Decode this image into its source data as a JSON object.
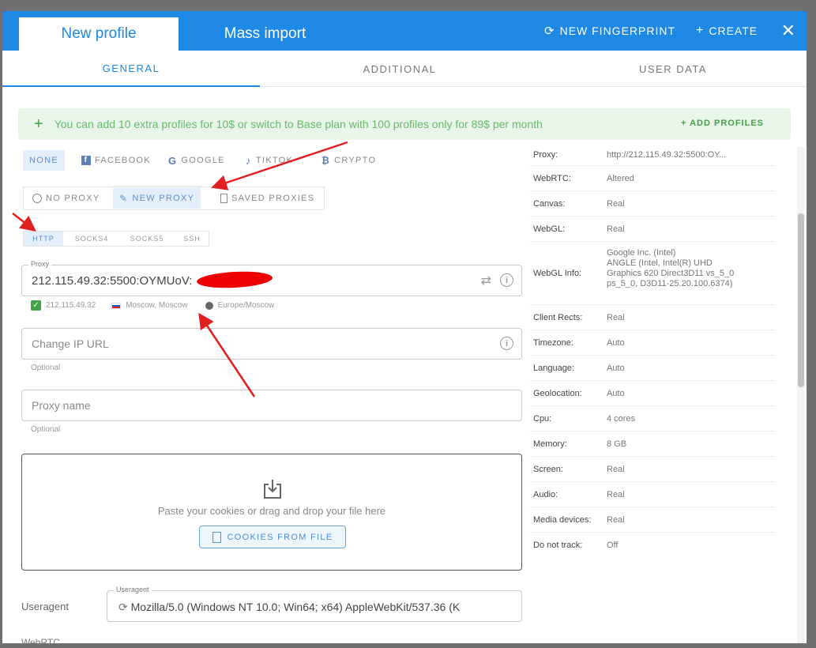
{
  "header": {
    "tab_new_profile": "New profile",
    "tab_mass_import": "Mass import",
    "new_fingerprint": "NEW FINGERPRINT",
    "create": "CREATE",
    "close": "✕"
  },
  "subtabs": [
    "GENERAL",
    "ADDITIONAL",
    "USER DATA"
  ],
  "banner": {
    "text": "You can add 10 extra profiles for 10$ or switch to Base plan with 100 profiles only for 89$ per month",
    "action": "+ ADD PROFILES"
  },
  "platforms": [
    "NONE",
    "FACEBOOK",
    "GOOGLE",
    "TIKTOK",
    "CRYPTO"
  ],
  "proxy_modes": [
    "NO PROXY",
    "NEW PROXY",
    "SAVED PROXIES"
  ],
  "proxy_types": [
    "HTTP",
    "SOCKS4",
    "SOCKS5",
    "SSH"
  ],
  "proxy_field": {
    "label": "Proxy",
    "value": "212.115.49.32:5500:OYMUoV:"
  },
  "proxy_check": {
    "ip": "212.115.49.32",
    "location": "Moscow, Moscow",
    "timezone": "Europe/Moscow"
  },
  "change_ip": {
    "placeholder": "Change IP URL",
    "hint": "Optional"
  },
  "proxy_name": {
    "placeholder": "Proxy name",
    "hint": "Optional"
  },
  "cookies": {
    "text": "Paste your cookies or drag and drop your file here",
    "button": "COOKIES FROM FILE"
  },
  "useragent": {
    "label": "Useragent",
    "field_label": "Useragent",
    "value": "Mozilla/5.0 (Windows NT 10.0; Win64; x64) AppleWebKit/537.36 (K"
  },
  "webrtc_label": "WebRTC",
  "fingerprint": [
    {
      "key": "Proxy:",
      "value": "http://212.115.49.32:5500:OY..."
    },
    {
      "key": "WebRTC:",
      "value": "Altered"
    },
    {
      "key": "Canvas:",
      "value": "Real"
    },
    {
      "key": "WebGL:",
      "value": "Real"
    },
    {
      "key": "WebGL Info:",
      "value": "Google Inc. (Intel)\nANGLE (Intel, Intel(R) UHD Graphics 620 Direct3D11 vs_5_0 ps_5_0, D3D11-25.20.100.6374)"
    },
    {
      "key": "Client Rects:",
      "value": "Real"
    },
    {
      "key": "Timezone:",
      "value": "Auto"
    },
    {
      "key": "Language:",
      "value": "Auto"
    },
    {
      "key": "Geolocation:",
      "value": "Auto"
    },
    {
      "key": "Cpu:",
      "value": "4 cores"
    },
    {
      "key": "Memory:",
      "value": "8 GB"
    },
    {
      "key": "Screen:",
      "value": "Real"
    },
    {
      "key": "Audio:",
      "value": "Real"
    },
    {
      "key": "Media devices:",
      "value": "Real"
    },
    {
      "key": "Do not track:",
      "value": "Off"
    }
  ],
  "colors": {
    "primary": "#1e88e5",
    "banner_bg": "#e8f5e9",
    "banner_text": "#66bb6a",
    "selected_chip_bg": "#e3f0fc",
    "annotation_red": "#e02020"
  }
}
